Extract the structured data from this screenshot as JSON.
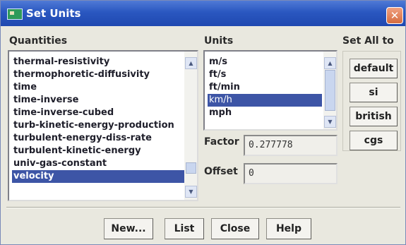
{
  "window": {
    "title": "Set Units",
    "close_symbol": "✕"
  },
  "quantities": {
    "label": "Quantities",
    "items": [
      "thermal-resistivity",
      "thermophoretic-diffusivity",
      "time",
      "time-inverse",
      "time-inverse-cubed",
      "turb-kinetic-energy-production",
      "turbulent-energy-diss-rate",
      "turbulent-kinetic-energy",
      "univ-gas-constant",
      "velocity"
    ],
    "selected": "velocity"
  },
  "units": {
    "label": "Units",
    "items": [
      "m/s",
      "ft/s",
      "ft/min",
      "km/h",
      "mph"
    ],
    "selected": "km/h"
  },
  "factor": {
    "label": "Factor",
    "value": "0.277778"
  },
  "offset": {
    "label": "Offset",
    "value": "0"
  },
  "set_all": {
    "label": "Set All to",
    "buttons": [
      "default",
      "si",
      "british",
      "cgs"
    ]
  },
  "footer": {
    "new_label": "New...",
    "list_label": "List",
    "close_label": "Close",
    "help_label": "Help"
  },
  "colors": {
    "title_bar": "#2a57c0",
    "selection": "#3d55a6",
    "dialog_bg": "#e9e8df"
  }
}
